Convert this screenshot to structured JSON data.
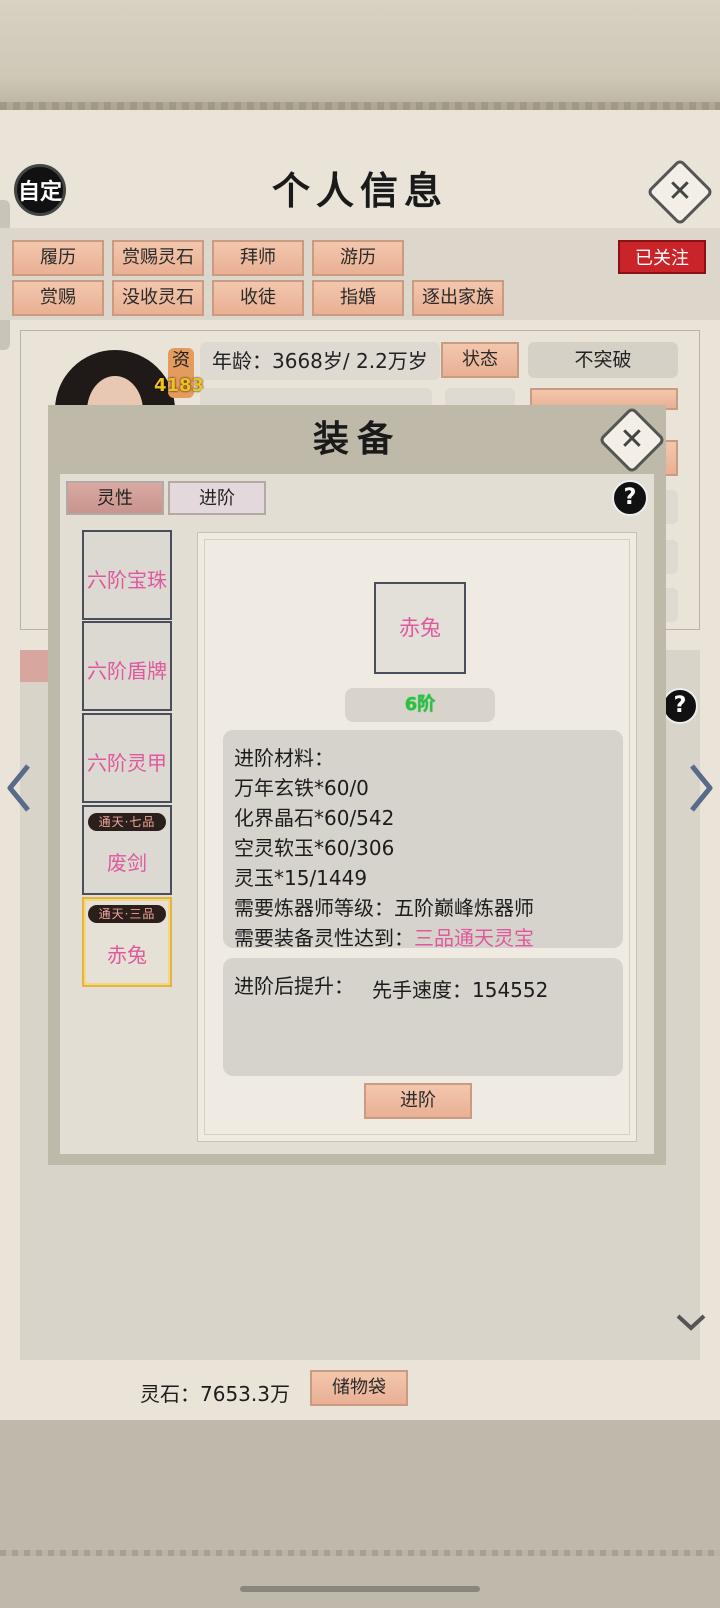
{
  "header": {
    "title": "个人信息",
    "custom_label": "自定",
    "close_glyph": "✕"
  },
  "actions": {
    "row1": [
      "履历",
      "赏赐灵石",
      "拜师",
      "游历"
    ],
    "row2": [
      "赏赐",
      "没收灵石",
      "收徒",
      "指婚",
      "逐出家族"
    ],
    "follow_label": "已关注"
  },
  "profile": {
    "zi_label": "资",
    "zi_value": "4183",
    "age_text": "年龄：3668岁/ 2.2万岁",
    "state_label": "状态",
    "breakthrough_status": "不突破"
  },
  "equip_modal": {
    "title": "装备",
    "close_glyph": "✕",
    "tabs": [
      {
        "label": "灵性",
        "active": true
      },
      {
        "label": "进阶",
        "active": false
      }
    ],
    "help_glyph": "?",
    "slots": [
      {
        "name": "六阶宝珠",
        "badge": ""
      },
      {
        "name": "六阶盾牌",
        "badge": ""
      },
      {
        "name": "六阶灵甲",
        "badge": ""
      },
      {
        "name": "废剑",
        "badge": "通天·七品"
      },
      {
        "name": "赤兔",
        "badge": "通天·三品",
        "selected": true
      }
    ],
    "selected_item": {
      "name": "赤兔",
      "tier": "6阶"
    },
    "materials": {
      "heading": "进阶材料：",
      "lines": [
        "万年玄铁*60/0",
        "化界晶石*60/542",
        "空灵软玉*60/306",
        "灵玉*15/1449",
        "需要炼器师等级：五阶巅峰炼器师"
      ],
      "req_label": "需要装备灵性达到：",
      "req_value": "三品通天灵宝"
    },
    "boost": {
      "label": "进阶后提升：",
      "value": "先手速度：154552"
    },
    "advance_button": "进阶"
  },
  "footer": {
    "spirit_stones": "灵石：7653.3万",
    "bag_button": "储物袋"
  },
  "colors": {
    "accent_button": "#e9b094",
    "follow_red": "#c8242a",
    "item_pink": "#e0589d",
    "tier_green": "#28c23c",
    "selected_gold": "#e0b543"
  }
}
